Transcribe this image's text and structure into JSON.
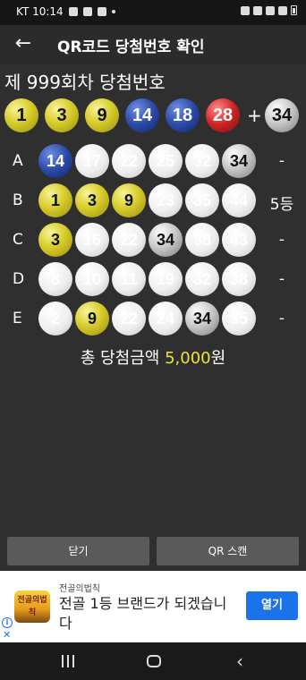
{
  "status_bar": {
    "carrier_time": "KT 10:14"
  },
  "app_bar": {
    "title": "QR코드 당첨번호 확인"
  },
  "draw": {
    "title": "제 999회차 당첨번호",
    "numbers": [
      {
        "value": "1",
        "color": "yellow"
      },
      {
        "value": "3",
        "color": "yellow"
      },
      {
        "value": "9",
        "color": "yellow"
      },
      {
        "value": "14",
        "color": "blue"
      },
      {
        "value": "18",
        "color": "blue"
      },
      {
        "value": "28",
        "color": "red"
      }
    ],
    "plus": "+",
    "bonus": {
      "value": "34",
      "color": "gray"
    }
  },
  "games": [
    {
      "label": "A",
      "result": "-",
      "numbers": [
        {
          "value": "14",
          "color": "blue"
        },
        {
          "value": "17",
          "color": "white"
        },
        {
          "value": "22",
          "color": "white"
        },
        {
          "value": "25",
          "color": "white"
        },
        {
          "value": "32",
          "color": "white"
        },
        {
          "value": "34",
          "color": "gray"
        }
      ]
    },
    {
      "label": "B",
      "result": "5등",
      "numbers": [
        {
          "value": "1",
          "color": "yellow"
        },
        {
          "value": "3",
          "color": "yellow"
        },
        {
          "value": "9",
          "color": "yellow"
        },
        {
          "value": "23",
          "color": "white"
        },
        {
          "value": "35",
          "color": "white"
        },
        {
          "value": "44",
          "color": "white"
        }
      ]
    },
    {
      "label": "C",
      "result": "-",
      "numbers": [
        {
          "value": "3",
          "color": "yellow"
        },
        {
          "value": "16",
          "color": "white"
        },
        {
          "value": "22",
          "color": "white"
        },
        {
          "value": "34",
          "color": "gray"
        },
        {
          "value": "38",
          "color": "white"
        },
        {
          "value": "43",
          "color": "white"
        }
      ]
    },
    {
      "label": "D",
      "result": "-",
      "numbers": [
        {
          "value": "8",
          "color": "white"
        },
        {
          "value": "10",
          "color": "white"
        },
        {
          "value": "11",
          "color": "white"
        },
        {
          "value": "19",
          "color": "white"
        },
        {
          "value": "32",
          "color": "white"
        },
        {
          "value": "38",
          "color": "white"
        }
      ]
    },
    {
      "label": "E",
      "result": "-",
      "numbers": [
        {
          "value": "2",
          "color": "white"
        },
        {
          "value": "9",
          "color": "yellow"
        },
        {
          "value": "22",
          "color": "white"
        },
        {
          "value": "24",
          "color": "white"
        },
        {
          "value": "34",
          "color": "gray"
        },
        {
          "value": "35",
          "color": "white"
        }
      ]
    }
  ],
  "total": {
    "label": "총 당첨금액 ",
    "amount": "5,000",
    "unit": "원"
  },
  "buttons": {
    "close": "닫기",
    "qr_scan": "QR 스캔"
  },
  "ad": {
    "sponsor": "전골의법칙",
    "headline": "전골 1등 브랜드가 되겠습니다",
    "open_button": "열기",
    "logo_text": "전골의법칙",
    "info_glyph": "i",
    "close_glyph": "✕"
  },
  "nav": {
    "back_glyph": "‹"
  },
  "colors": {
    "background": "#2f2f2f",
    "yellow_ball": "#d7cc2b",
    "blue_ball": "#2a4aa8",
    "red_ball": "#cf2323",
    "gray_ball": "#c9c9c9",
    "white_ball": "#eeeeee",
    "amount": "#f0e23a",
    "ad_button": "#1a73e8"
  }
}
